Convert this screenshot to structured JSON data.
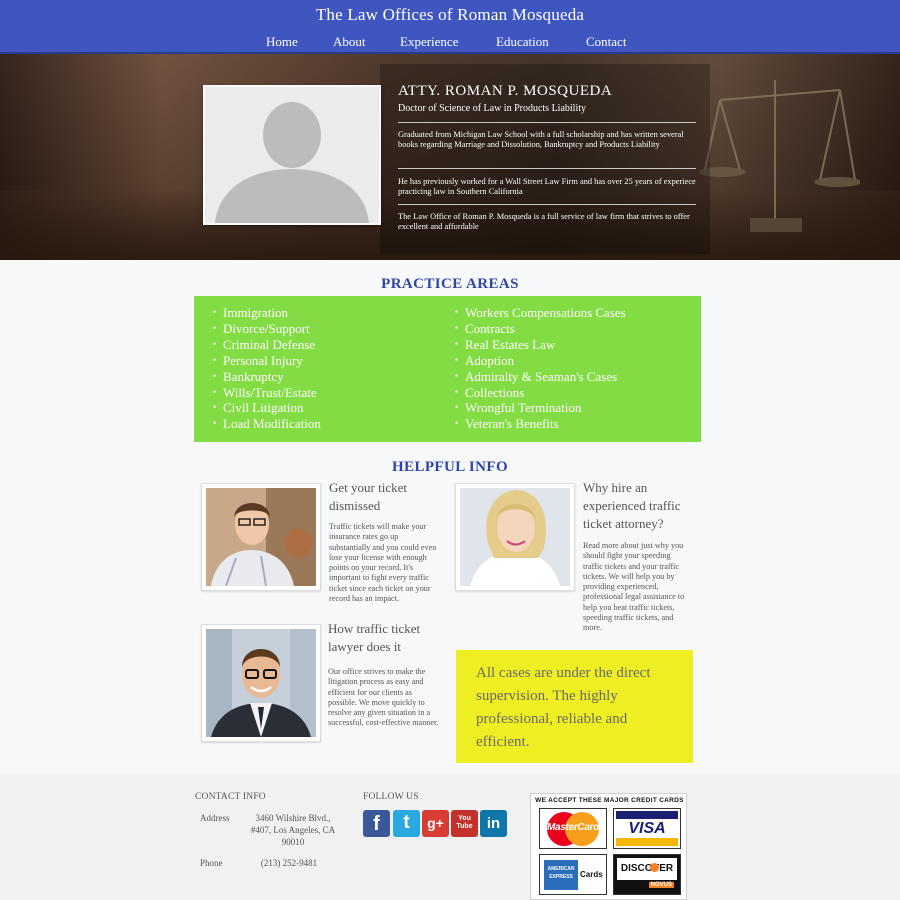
{
  "header": {
    "title": "The Law Offices of Roman Mosqueda",
    "nav": [
      "Home",
      "About",
      "Experience",
      "Education",
      "Contact"
    ]
  },
  "hero": {
    "name": "ATTY. ROMAN P. MOSQUEDA",
    "degree": "Doctor of Science of Law in Products Liability",
    "paragraphs": [
      "Graduated from Michigan Law School with a full scholarship and has written several books regarding Marriage and Dissolution, Bankruptcy and Products Liability",
      "He has previously worked for a Wall Street Law Firm and has over 25 years of experiece practicing law in Southern California",
      "The Law Office of Roman P. Mosqueda is a full service of law firm that strives to offer excellent and affordable"
    ]
  },
  "practice": {
    "title": "PRACTICE AREAS",
    "left": [
      "Immigration",
      "Divorce/Support",
      "Criminal Defense",
      "Personal Injury",
      "Bankruptcy",
      "Wills/Trust/Estate",
      "Civil Litigation",
      "Load Modification"
    ],
    "right": [
      "Workers Compensations Cases",
      "Contracts",
      "Real Estates Law",
      "Adoption",
      "Admiralty & Seaman's Cases",
      "Collections",
      "Wrongful Termination",
      "Veteran's Benefits"
    ],
    "box_color": "#84dc44"
  },
  "helpful": {
    "title": "HELPFUL INFO",
    "items": [
      {
        "title": "Get your ticket dismissed",
        "body": "Traffic tickets will make your insurance rates go up substantially and you could even lose your license with enough points on your record. It's important to fight every traffic ticket since each ticket on your record has an impact."
      },
      {
        "title": "Why hire an experienced traffic ticket attorney?",
        "body": "Read more about just why you should fight your speeding traffic tickets and your traffic tickets. We will help you by providing experienced, professional legal assistance to help you beat traffic tickets, speeding traffic tickets, and more."
      },
      {
        "title": "How traffic ticket lawyer does it",
        "body": "Our office strives to make the litigation process as easy and efficient for our clients as possible. We move quickly to resolve any given situation in a successful, cost-effective manner."
      }
    ],
    "highlight": "All cases are under the direct supervision. The highly professional, reliable and efficient.",
    "highlight_color": "#efee22"
  },
  "footer": {
    "contact_heading": "CONTACT INFO",
    "address_label": "Address",
    "address_line1": "3460 Wilshire Blvd.,",
    "address_line2": "#407, Los Angeles, CA",
    "address_line3": "90010",
    "phone_label": "Phone",
    "phone": "(213) 252-9481",
    "follow_heading": "FOLLOW US",
    "social": [
      {
        "name": "facebook-icon",
        "glyph": "f",
        "color": "#3b5998"
      },
      {
        "name": "twitter-icon",
        "glyph": "t",
        "color": "#2aa9e0"
      },
      {
        "name": "google-plus-icon",
        "glyph": "g+",
        "color": "#d73d32"
      },
      {
        "name": "youtube-icon",
        "glyph": "You Tube",
        "color": "#c4302b"
      },
      {
        "name": "linkedin-icon",
        "glyph": "in",
        "color": "#0e76a8"
      }
    ],
    "cards_title": "WE ACCEPT THESE MAJOR CREDIT CARDS",
    "cards": {
      "mastercard": "MasterCard",
      "visa": "VISA",
      "amex_line1": "AMERICAN",
      "amex_line2": "EXPRESS",
      "amex_cards": "Cards",
      "discover": "DISCOVER",
      "novus": "NOVUS"
    }
  },
  "colors": {
    "header": "#3f56c0",
    "section_title": "#2e45a8"
  }
}
